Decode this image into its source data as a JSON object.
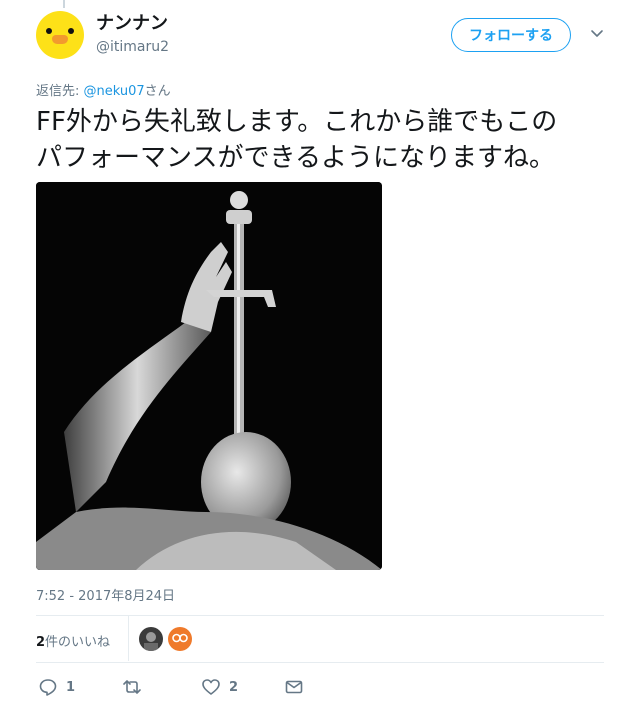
{
  "user": {
    "display_name": "ナンナン",
    "handle": "@itimaru2",
    "avatar_icon": "chick-avatar"
  },
  "follow_button": {
    "label": "フォローする",
    "color": "#1da1f2"
  },
  "menu_icon": "chevron-down-icon",
  "reply_to": {
    "prefix": "返信先: ",
    "mention": "@neku07",
    "suffix": "さん"
  },
  "tweet": {
    "text_line1": "FF外から失礼致します。これから誰でもこの",
    "text_line2": "パフォーマンスができるようになりますね。",
    "media_icon": "photo-sword-swallower"
  },
  "timestamp": "7:52 - 2017年8月24日",
  "likes": {
    "count": "2",
    "label": "件のいいね",
    "likers": [
      "liker-avatar-1",
      "liker-avatar-2"
    ]
  },
  "actions": {
    "reply_count": "1",
    "retweet_count": "",
    "like_count": "2",
    "icons": [
      "reply-icon",
      "retweet-icon",
      "heart-icon",
      "envelope-icon"
    ]
  }
}
